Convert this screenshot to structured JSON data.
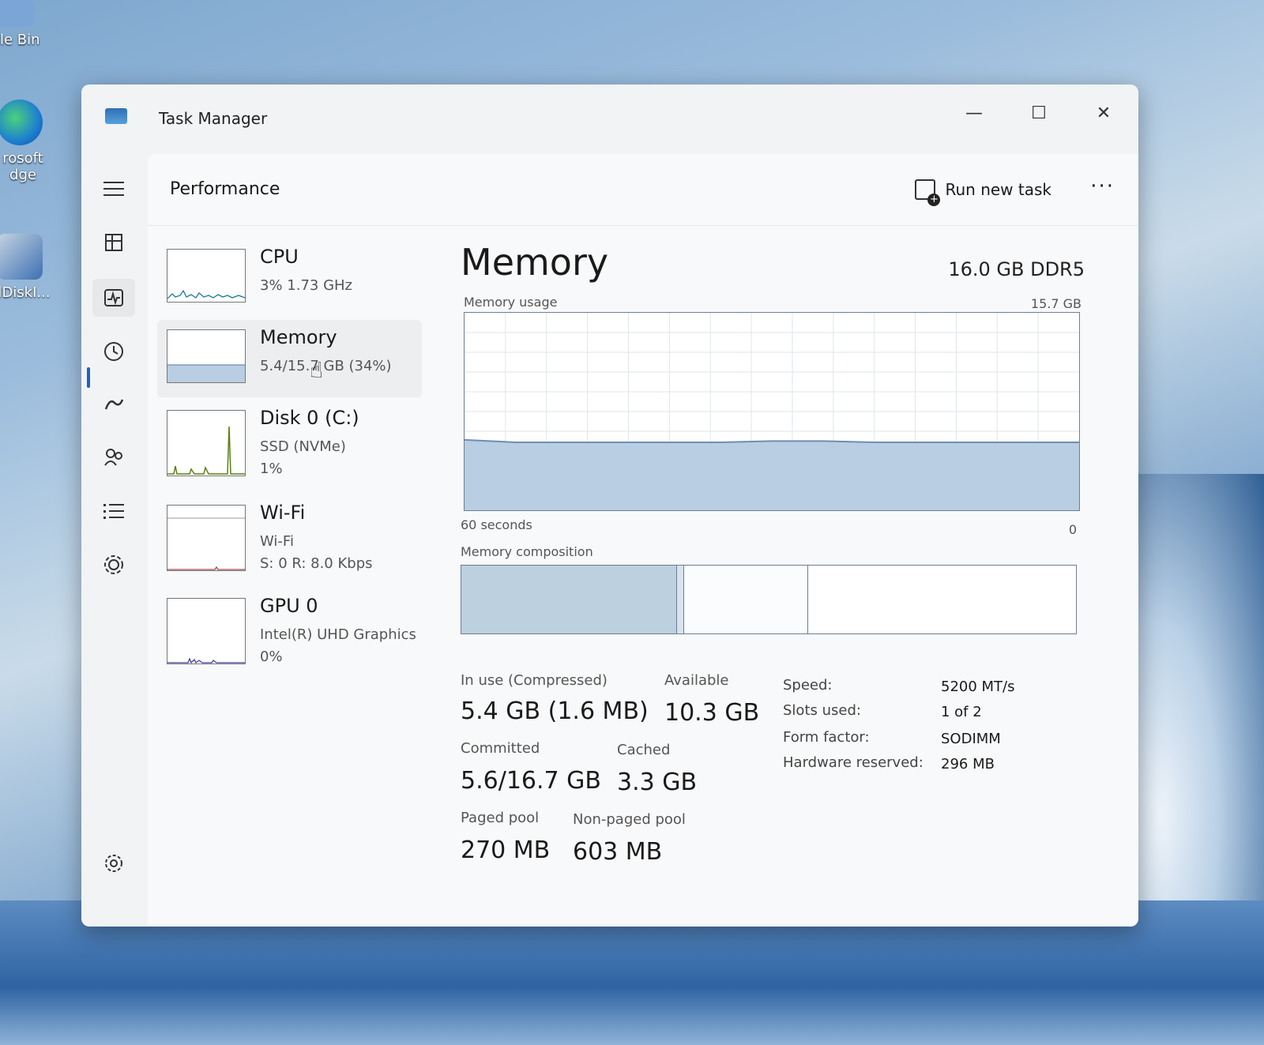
{
  "desktop": {
    "icons": [
      {
        "label": "ycle Bin"
      },
      {
        "label": "rosoft dge"
      },
      {
        "label": "alDiskI..."
      }
    ]
  },
  "window": {
    "title": "Task Manager",
    "controls": {
      "minimize": "—",
      "maximize": "☐",
      "close": "✕"
    }
  },
  "toolbar": {
    "page_title": "Performance",
    "run_new_task": "Run new task",
    "more": "···"
  },
  "tiles": [
    {
      "name": "CPU",
      "line1": "3%  1.73 GHz",
      "line2": ""
    },
    {
      "name": "Memory",
      "line1": "5.4/15.7 GB (34%)",
      "line2": ""
    },
    {
      "name": "Disk 0 (C:)",
      "line1": "SSD (NVMe)",
      "line2": "1%"
    },
    {
      "name": "Wi-Fi",
      "line1": "Wi-Fi",
      "line2": "S: 0  R: 8.0 Kbps"
    },
    {
      "name": "GPU 0",
      "line1": "Intel(R) UHD Graphics",
      "line2": "0%"
    }
  ],
  "detail": {
    "title": "Memory",
    "spec": "16.0 GB DDR5",
    "usage_label": "Memory usage",
    "usage_max": "15.7 GB",
    "time_left": "60 seconds",
    "time_right": "0",
    "composition_label": "Memory composition",
    "composition": {
      "in_use_fraction": 0.35,
      "modified_fraction": 0.01,
      "standby_fraction": 0.2
    },
    "stats": {
      "in_use_label": "In use (Compressed)",
      "in_use_value": "5.4 GB (1.6 MB)",
      "available_label": "Available",
      "available_value": "10.3 GB",
      "committed_label": "Committed",
      "committed_value": "5.6/16.7 GB",
      "cached_label": "Cached",
      "cached_value": "3.3 GB",
      "paged_label": "Paged pool",
      "paged_value": "270 MB",
      "nonpaged_label": "Non-paged pool",
      "nonpaged_value": "603 MB"
    },
    "props": [
      {
        "label": "Speed:",
        "value": "5200 MT/s"
      },
      {
        "label": "Slots used:",
        "value": "1 of 2"
      },
      {
        "label": "Form factor:",
        "value": "SODIMM"
      },
      {
        "label": "Hardware reserved:",
        "value": "296 MB"
      }
    ]
  },
  "chart_data": {
    "type": "area",
    "xlabel": "60 seconds",
    "ylim": [
      0,
      15.7
    ],
    "x": [
      60,
      55,
      50,
      45,
      40,
      35,
      30,
      25,
      20,
      15,
      10,
      5,
      0
    ],
    "series": [
      {
        "values": [
          5.6,
          5.4,
          5.4,
          5.4,
          5.4,
          5.4,
          5.5,
          5.5,
          5.4,
          5.4,
          5.4,
          5.4,
          5.4
        ]
      }
    ],
    "grid": true
  },
  "colors": {
    "accent": "#1a62c4",
    "memory_fill": "#b9cee2",
    "memory_line": "#6f8eb0"
  }
}
